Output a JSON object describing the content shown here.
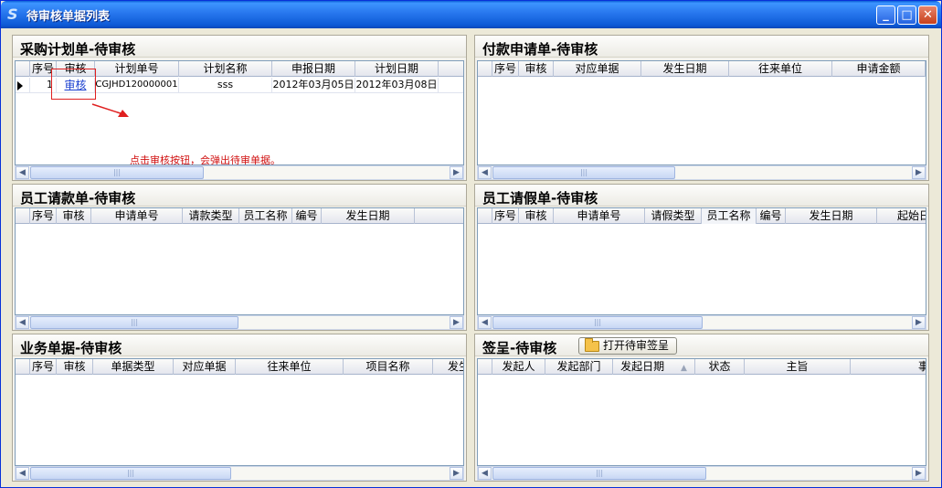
{
  "window": {
    "title": "待审核单据列表"
  },
  "panels": {
    "purchase": {
      "title": "采购计划单-待审核",
      "columns": [
        "序号",
        "审核",
        "计划单号",
        "计划名称",
        "申报日期",
        "计划日期"
      ],
      "rows": [
        {
          "seq": "1",
          "audit": "审核",
          "plan_no": "CGJHD120000001",
          "plan_name": "sss",
          "report_date": "2012年03月05日",
          "plan_date": "2012年03月08日"
        }
      ],
      "annotation": "点击审核按钮，会弹出待审单据。"
    },
    "payment": {
      "title": "付款申请单-待审核",
      "columns": [
        "序号",
        "审核",
        "对应单据",
        "发生日期",
        "往来单位",
        "申请金额"
      ]
    },
    "expense": {
      "title": "员工请款单-待审核",
      "columns": [
        "序号",
        "审核",
        "申请单号",
        "请款类型",
        "员工名称",
        "编号",
        "发生日期"
      ]
    },
    "leave": {
      "title": "员工请假单-待审核",
      "columns": [
        "序号",
        "审核",
        "申请单号",
        "请假类型",
        "员工名称",
        "编号",
        "发生日期",
        "起始日"
      ]
    },
    "business": {
      "title": "业务单据-待审核",
      "columns": [
        "序号",
        "审核",
        "单据类型",
        "对应单据",
        "往来单位",
        "项目名称",
        "发生"
      ]
    },
    "signoff": {
      "title": "签呈-待审核",
      "open_button": "打开待审签呈",
      "columns": [
        "发起人",
        "发起部门",
        "发起日期",
        "状态",
        "主旨",
        "事"
      ]
    }
  },
  "scrollbar": {
    "grip": "|||"
  }
}
